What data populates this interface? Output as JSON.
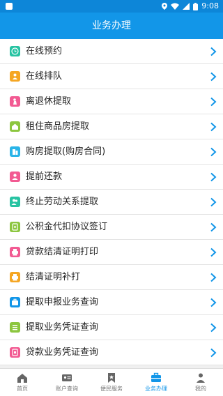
{
  "status_bar": {
    "time": "9:08",
    "accent": "#0d86d8"
  },
  "header": {
    "title": "业务办理",
    "color": "#1296e8"
  },
  "menu": [
    {
      "label": "在线预约",
      "icon": "clock-icon",
      "color": "#27c3a2"
    },
    {
      "label": "在线排队",
      "icon": "person-queue-icon",
      "color": "#f5a623"
    },
    {
      "label": "离退休提取",
      "icon": "retire-icon",
      "color": "#f25a92"
    },
    {
      "label": "租住商品房提取",
      "icon": "house-icon",
      "color": "#8cc63f"
    },
    {
      "label": "购房提取(购房合同)",
      "icon": "building-icon",
      "color": "#2ab4e8"
    },
    {
      "label": "提前还款",
      "icon": "user-icon",
      "color": "#f25a92"
    },
    {
      "label": "终止劳动关系提取",
      "icon": "users-icon",
      "color": "#27c3a2"
    },
    {
      "label": "公积金代扣协议签订",
      "icon": "document-icon",
      "color": "#8cc63f"
    },
    {
      "label": "贷款结清证明打印",
      "icon": "printer-icon",
      "color": "#f25a92"
    },
    {
      "label": "结清证明补打",
      "icon": "printer-icon",
      "color": "#f5a623"
    },
    {
      "label": "提取申报业务查询",
      "icon": "briefcase-icon",
      "color": "#1296e8"
    },
    {
      "label": "提取业务凭证查询",
      "icon": "list-icon",
      "color": "#8cc63f"
    },
    {
      "label": "贷款业务凭证查询",
      "icon": "doc-search-icon",
      "color": "#f25a92"
    }
  ],
  "tabs": [
    {
      "label": "首页",
      "icon": "home-icon",
      "active": false
    },
    {
      "label": "账户查询",
      "icon": "id-card-icon",
      "active": false
    },
    {
      "label": "便民服务",
      "icon": "bookmark-icon",
      "active": false
    },
    {
      "label": "业务办理",
      "icon": "briefcase-icon",
      "active": true
    },
    {
      "label": "我的",
      "icon": "profile-icon",
      "active": false
    }
  ]
}
